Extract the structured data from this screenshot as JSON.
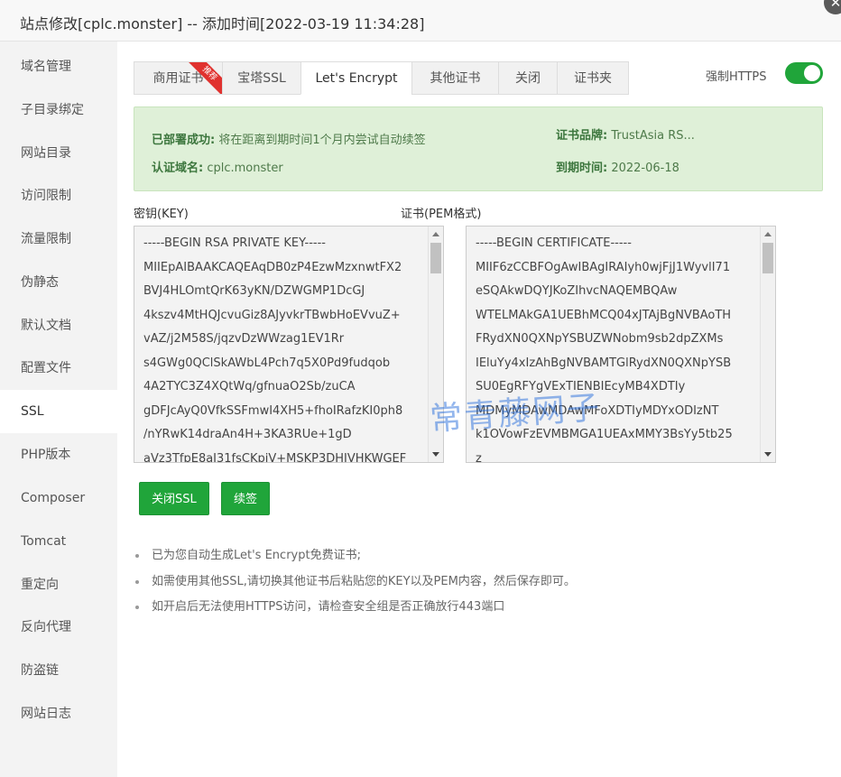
{
  "window": {
    "title": "站点修改[cplc.monster] -- 添加时间[2022-03-19 11:34:28]",
    "close_icon": "close-icon"
  },
  "sidebar": {
    "items": [
      {
        "label": "域名管理"
      },
      {
        "label": "子目录绑定"
      },
      {
        "label": "网站目录"
      },
      {
        "label": "访问限制"
      },
      {
        "label": "流量限制"
      },
      {
        "label": "伪静态"
      },
      {
        "label": "默认文档"
      },
      {
        "label": "配置文件"
      },
      {
        "label": "SSL",
        "active": true
      },
      {
        "label": "PHP版本"
      },
      {
        "label": "Composer"
      },
      {
        "label": "Tomcat"
      },
      {
        "label": "重定向"
      },
      {
        "label": "反向代理"
      },
      {
        "label": "防盗链"
      },
      {
        "label": "网站日志"
      }
    ]
  },
  "tabs": [
    {
      "label": "商用证书",
      "badge": "推荐"
    },
    {
      "label": "宝塔SSL"
    },
    {
      "label": "Let's Encrypt",
      "active": true
    },
    {
      "label": "其他证书"
    },
    {
      "label": "关闭"
    },
    {
      "label": "证书夹"
    }
  ],
  "force_https": {
    "label": "强制HTTPS",
    "on": true,
    "color": "#20a53a"
  },
  "info": {
    "deploy_label": "已部署成功:",
    "deploy_value": "将在距离到期时间1个月内尝试自动续签",
    "domain_label": "认证域名:",
    "domain_value": "cplc.monster",
    "brand_label": "证书品牌:",
    "brand_value": "TrustAsia RS...",
    "expire_label": "到期时间:",
    "expire_value": "2022-06-18"
  },
  "key": {
    "label": "密钥(KEY)",
    "lines": [
      "-----BEGIN RSA PRIVATE KEY-----",
      "MIIEpAIBAAKCAQEAqDB0zP4EzwMzxnwtFX2",
      "BVJ4HLOmtQrK63yKN/DZWGMP1DcGJ",
      "4kszv4MtHQJcvuGiz8AJyvkrTBwbHoEVvuZ+",
      "vAZ/j2M58S/jqzvDzWWzag1EV1Rr",
      "s4GWg0QClSkAWbL4Pch7q5X0Pd9fudqob",
      "4A2TYC3Z4XQtWq/gfnuaO2Sb/zuCA",
      "gDFJcAyQ0VfkSSFmwI4XH5+fhoIRafzKI0ph8",
      "/nYRwK14draAn4H+3KA3RUe+1gD",
      "aVz3TfpE8aI31fsCKpiV+MSKP3DHIVHKWGEF"
    ]
  },
  "cert": {
    "label": "证书(PEM格式)",
    "lines": [
      "-----BEGIN CERTIFICATE-----",
      "MIIF6zCCBFOgAwIBAgIRAIyh0wjFjJ1WyvlI71",
      "eSQAkwDQYJKoZIhvcNAQEMBQAw",
      "WTELMAkGA1UEBhMCQ04xJTAjBgNVBAoTH",
      "FRydXN0QXNpYSBUZWNobm9sb2dpZXMs",
      "IEluYy4xIzAhBgNVBAMTGlRydXN0QXNpYSB",
      "SU0EgRFYgVExTIENBIEcyMB4XDTIy",
      "MDMyMDAwMDAwMFoXDTIyMDYxODIzNT",
      "k1OVowFzEVMBMGA1UEAxMMY3BsYy5tb25",
      "z"
    ]
  },
  "buttons": {
    "close_ssl": "关闭SSL",
    "renew": "续签"
  },
  "tips": [
    "已为您自动生成Let's Encrypt免费证书;",
    "如需使用其他SSL,请切换其他证书后粘贴您的KEY以及PEM内容，然后保存即可。",
    "如开启后无法使用HTTPS访问，请检查安全组是否正确放行443端口"
  ],
  "watermark": "常青藤网子"
}
